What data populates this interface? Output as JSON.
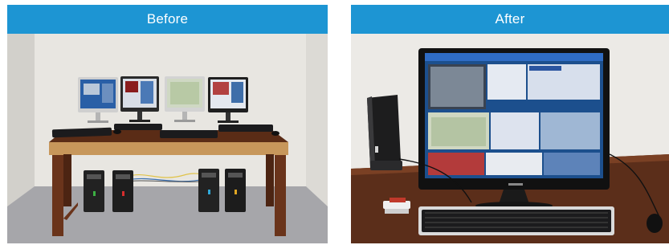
{
  "colors": {
    "banner": "#1d95d3",
    "wall": "#e7e5e0",
    "floor": "#a7a7ab",
    "desk_wood": "#6b351d",
    "desk_top_edge": "#c99a5e",
    "screen_blue": "#2b5fa8",
    "keyboard": "#1b1b1d"
  },
  "panels": {
    "before": {
      "label": "Before"
    },
    "after": {
      "label": "After"
    }
  }
}
